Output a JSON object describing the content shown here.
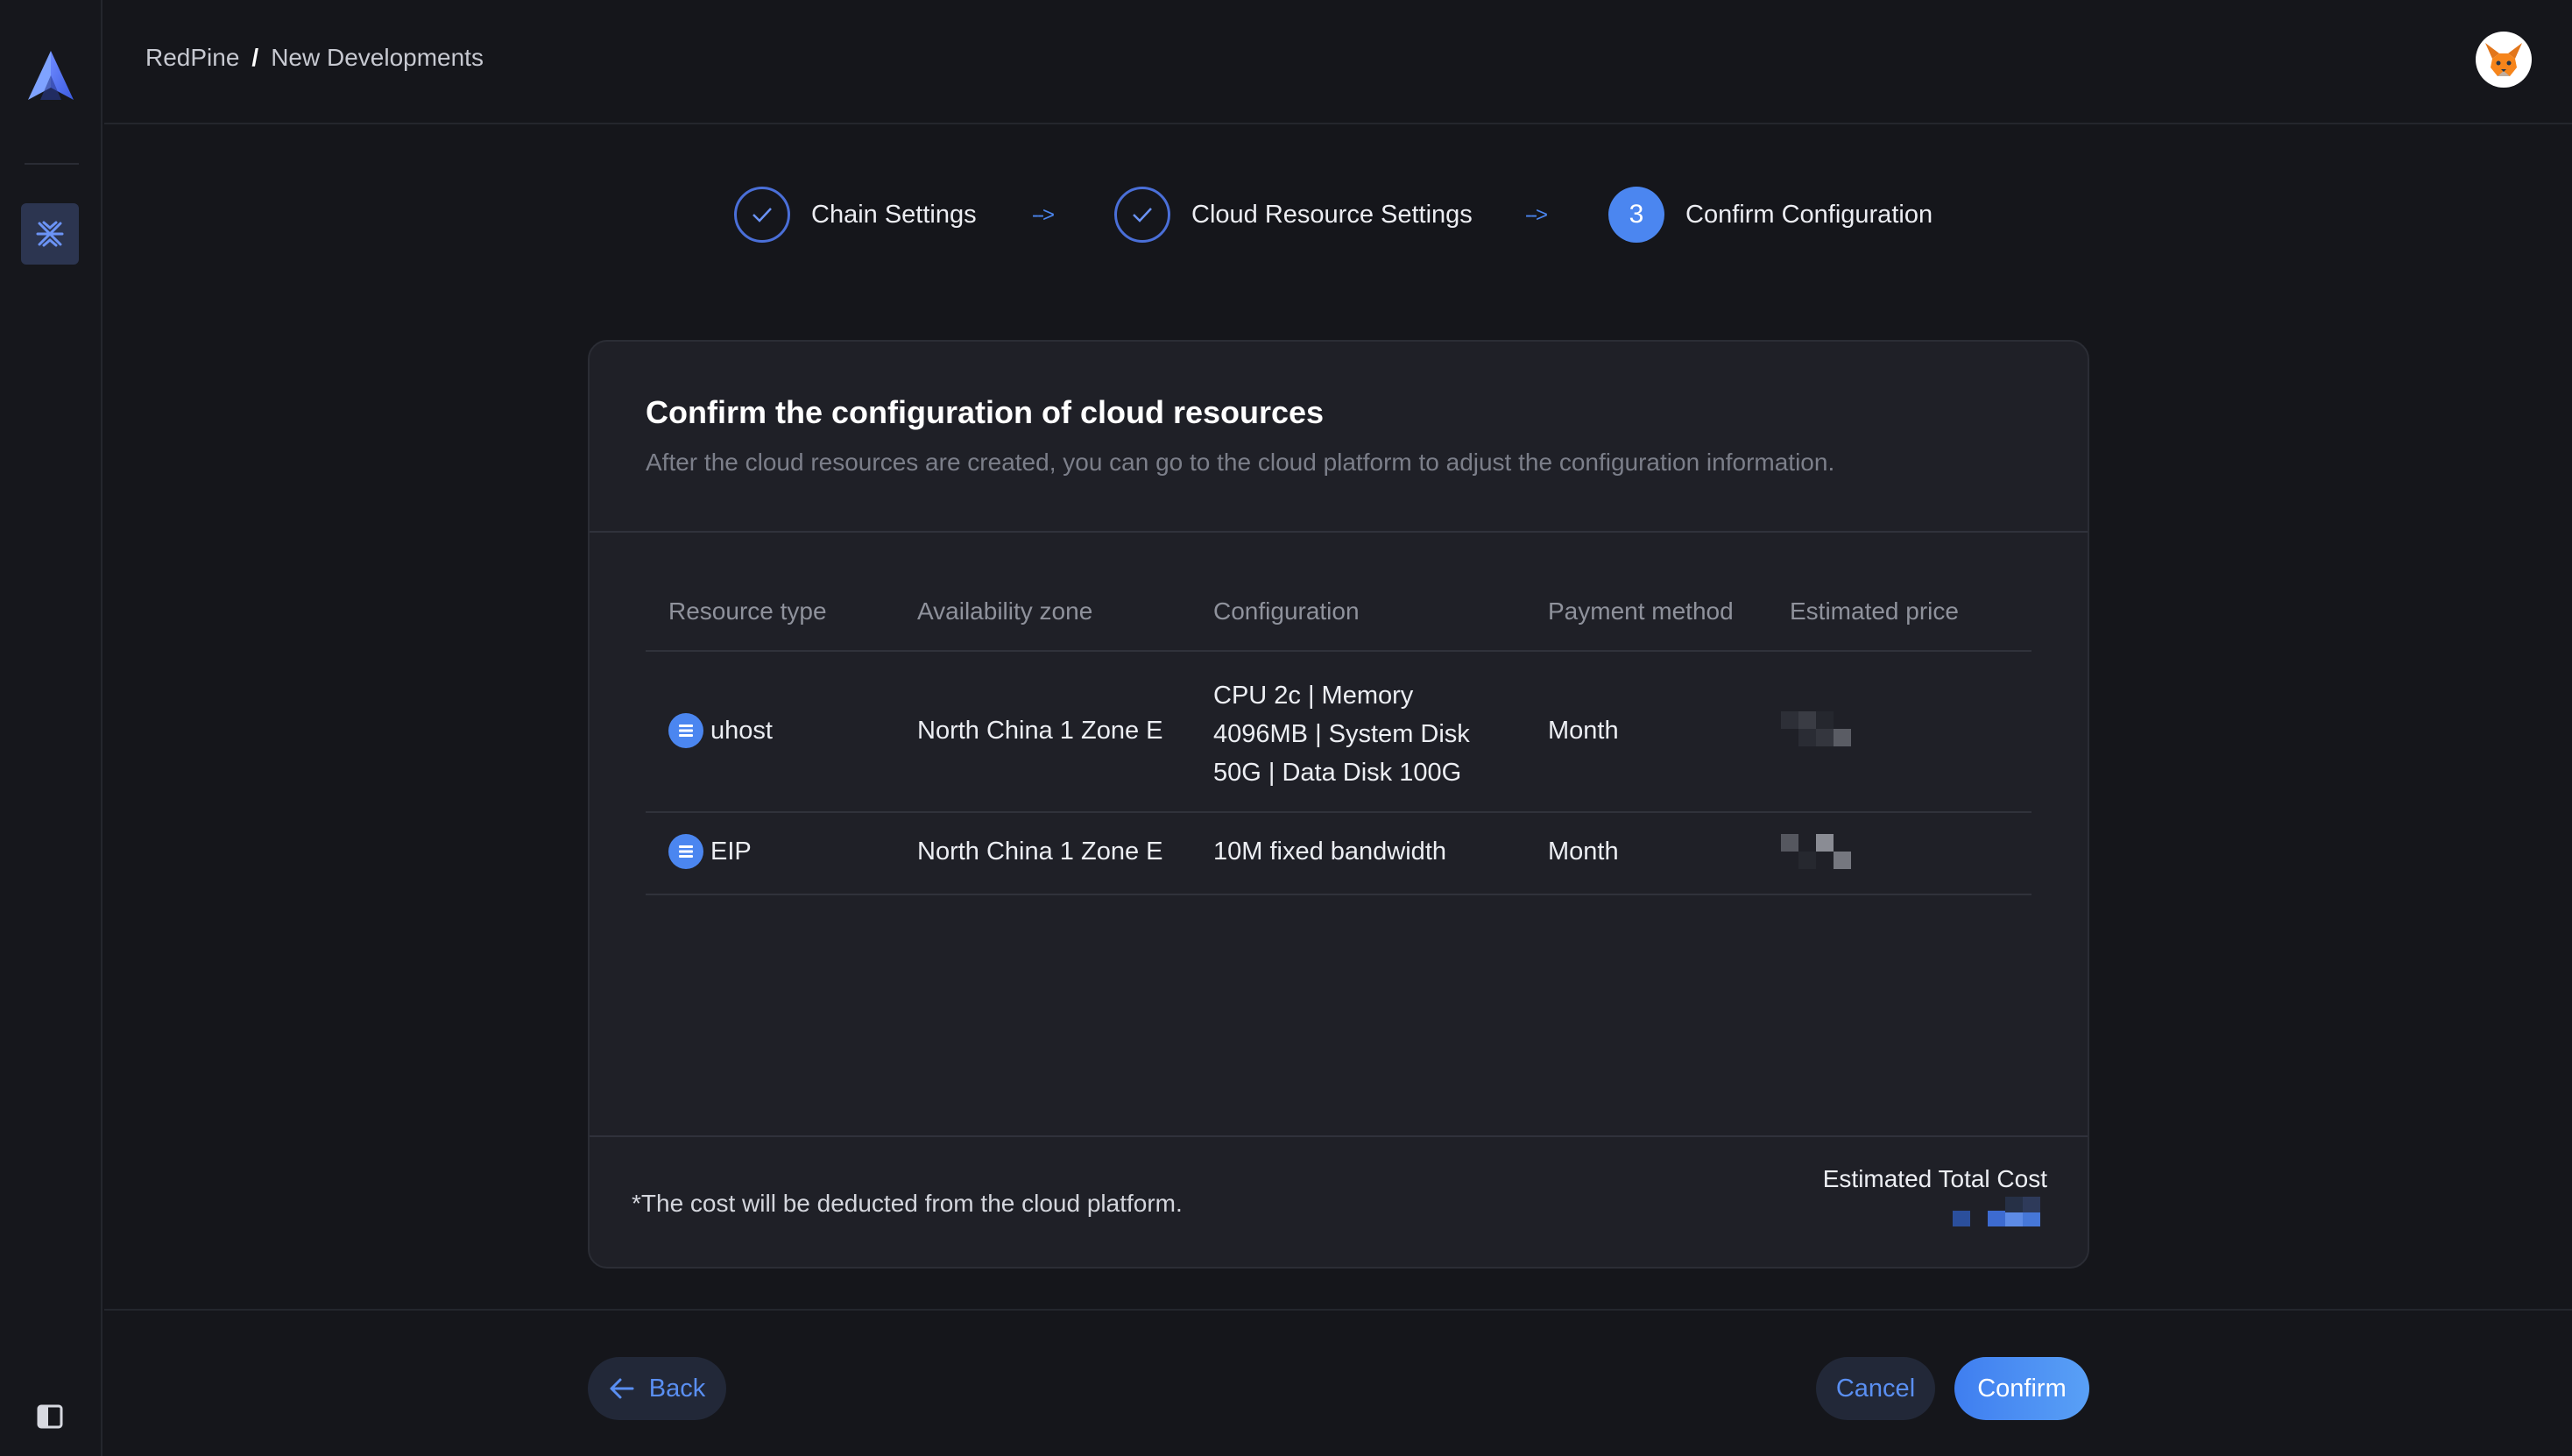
{
  "breadcrumb": {
    "root": "RedPine",
    "separator": "/",
    "current": "New Developments"
  },
  "steps": [
    {
      "label": "Chain Settings",
      "status": "done",
      "icon": "check-icon"
    },
    {
      "label": "Cloud Resource Settings",
      "status": "done",
      "icon": "check-icon"
    },
    {
      "label": "Confirm Configuration",
      "status": "active",
      "number": "3"
    }
  ],
  "step_arrow": "-->",
  "card": {
    "title": "Confirm the configuration of cloud resources",
    "subtitle": "After the cloud resources are created, you can go to the cloud platform to adjust the configuration information."
  },
  "table": {
    "headers": [
      "Resource type",
      "Availability zone",
      "Configuration",
      "Payment method",
      "Estimated price"
    ],
    "rows": [
      {
        "type": "uhost",
        "zone": "North China 1 Zone E",
        "config": "CPU 2c | Memory 4096MB | System Disk 50G | Data Disk 100G",
        "payment": "Month",
        "price_state": "pixelated"
      },
      {
        "type": "EIP",
        "zone": "North China 1 Zone E",
        "config": "10M fixed bandwidth",
        "payment": "Month",
        "price_state": "pixelated"
      }
    ]
  },
  "footer": {
    "note": "*The cost will be deducted from the cloud platform.",
    "total_label": "Estimated Total Cost"
  },
  "buttons": {
    "back": "Back",
    "cancel": "Cancel",
    "confirm": "Confirm"
  },
  "icons": {
    "logo": "app-logo-icon",
    "nav": "network-icon",
    "avatar": "fox-avatar-icon",
    "collapse": "sidebar-collapse-icon",
    "back": "arrow-left-icon",
    "row_type": "server-icon"
  },
  "colors": {
    "accent": "#4b86f0",
    "background": "#15161b",
    "card": "#1f2027"
  }
}
